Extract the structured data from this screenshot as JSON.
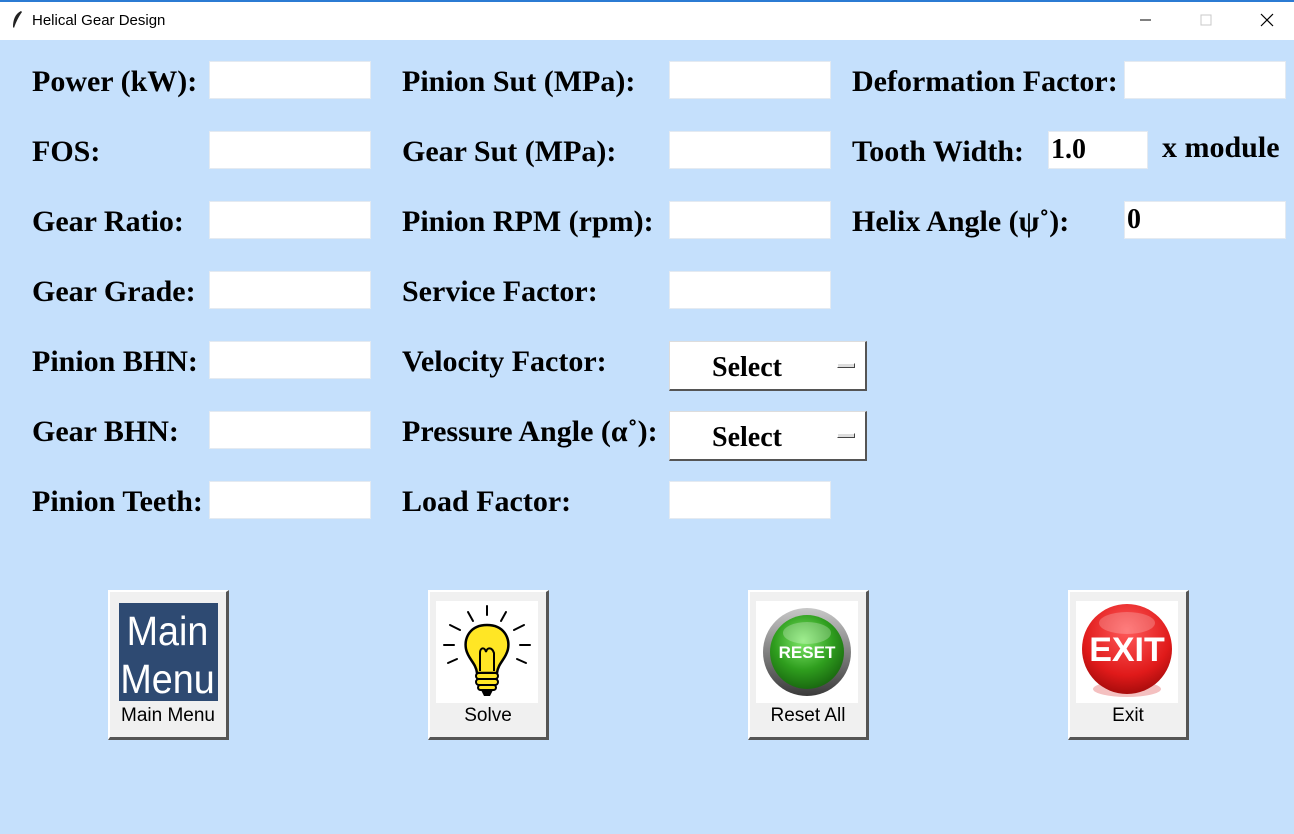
{
  "window": {
    "title": "Helical Gear Design"
  },
  "labels": {
    "power": "Power (kW):",
    "fos": "FOS:",
    "gear_ratio": "Gear Ratio:",
    "gear_grade": "Gear Grade:",
    "pinion_bhn": "Pinion BHN:",
    "gear_bhn": "Gear BHN:",
    "pinion_teeth": "Pinion Teeth:",
    "pinion_sut": "Pinion Sut (MPa):",
    "gear_sut": "Gear Sut (MPa):",
    "pinion_rpm": "Pinion RPM (rpm):",
    "service_factor": "Service Factor:",
    "velocity_factor": "Velocity Factor:",
    "pressure_angle": "Pressure Angle (α˚):",
    "load_factor": "Load Factor:",
    "deformation_factor": "Deformation Factor:",
    "tooth_width": "Tooth Width:",
    "tooth_width_unit": "x module",
    "helix_angle": "Helix Angle (ψ˚):"
  },
  "fields": {
    "power": "",
    "fos": "",
    "gear_ratio": "",
    "gear_grade": "",
    "pinion_bhn": "",
    "gear_bhn": "",
    "pinion_teeth": "",
    "pinion_sut": "",
    "gear_sut": "",
    "pinion_rpm": "",
    "service_factor": "",
    "load_factor": "",
    "deformation_factor": "",
    "tooth_width": "1.0",
    "helix_angle": "0"
  },
  "dropdowns": {
    "velocity_factor": "Select",
    "pressure_angle": "Select"
  },
  "buttons": {
    "main_menu": {
      "label": "Main Menu",
      "image_text": [
        "Main",
        "Menu"
      ],
      "icon": "main-menu-icon"
    },
    "solve": {
      "label": "Solve",
      "icon": "lightbulb-icon"
    },
    "reset": {
      "label": "Reset All",
      "image_text": "RESET",
      "icon": "reset-icon"
    },
    "exit": {
      "label": "Exit",
      "image_text": "EXIT",
      "icon": "exit-icon"
    }
  },
  "colors": {
    "background": "#c5e0fc",
    "main_menu_bg": "#2e4a72",
    "reset_green": "#2f9e1e",
    "exit_red": "#e01a1a",
    "bulb_yellow": "#ffe625"
  }
}
